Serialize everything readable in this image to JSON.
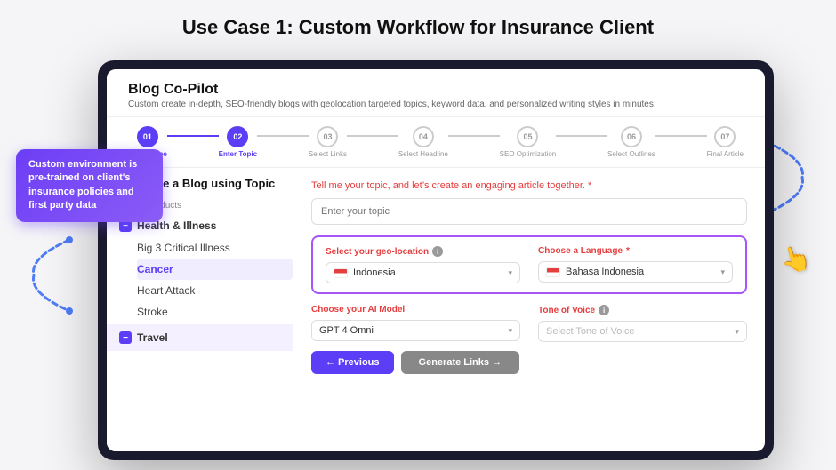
{
  "page": {
    "title": "Use Case 1: Custom Workflow for Insurance Client"
  },
  "blog": {
    "title": "Blog Co-Pilot",
    "subtitle": "Custom create in-depth, SEO-friendly blogs with geolocation targeted topics, keyword data, and personalized writing styles in minutes."
  },
  "stepper": {
    "steps": [
      {
        "number": "01",
        "label": "Select Type",
        "state": "done"
      },
      {
        "number": "02",
        "label": "Enter Topic",
        "state": "active"
      },
      {
        "number": "03",
        "label": "Select Links",
        "state": "default"
      },
      {
        "number": "04",
        "label": "Select Headline",
        "state": "default"
      },
      {
        "number": "05",
        "label": "SEO Optimization",
        "state": "default"
      },
      {
        "number": "06",
        "label": "Select Outlines",
        "state": "default"
      },
      {
        "number": "07",
        "label": "Final Article",
        "state": "default"
      }
    ]
  },
  "sidebar": {
    "title": "Generate a Blog using Topic",
    "section_label": "Select Products",
    "categories": [
      {
        "name": "Health & Illness",
        "items": [
          "Big 3 Critical Illness",
          "Cancer",
          "Heart Attack",
          "Stroke"
        ],
        "selected_item": "Cancer",
        "expanded": true
      },
      {
        "name": "Travel",
        "expanded": false
      }
    ]
  },
  "form": {
    "topic_label": "Tell me your topic, and let’s create an engaging article together.",
    "topic_placeholder": "Enter your topic",
    "geo_label": "Select your geo-location",
    "geo_value": "Indonesia",
    "lang_label": "Choose a Language",
    "lang_value": "Bahasa Indonesia",
    "model_label": "Choose your AI Model",
    "model_value": "GPT 4 Omni",
    "tone_label": "Tone of Voice",
    "tone_placeholder": "Select Tone of Voice"
  },
  "buttons": {
    "previous": "← Previous",
    "generate": "Generate Links →"
  },
  "tooltip": {
    "text": "Custom environment is pre-trained on client's insurance policies and first party data"
  },
  "decorative": {
    "arc_color": "#4f7cf7"
  }
}
